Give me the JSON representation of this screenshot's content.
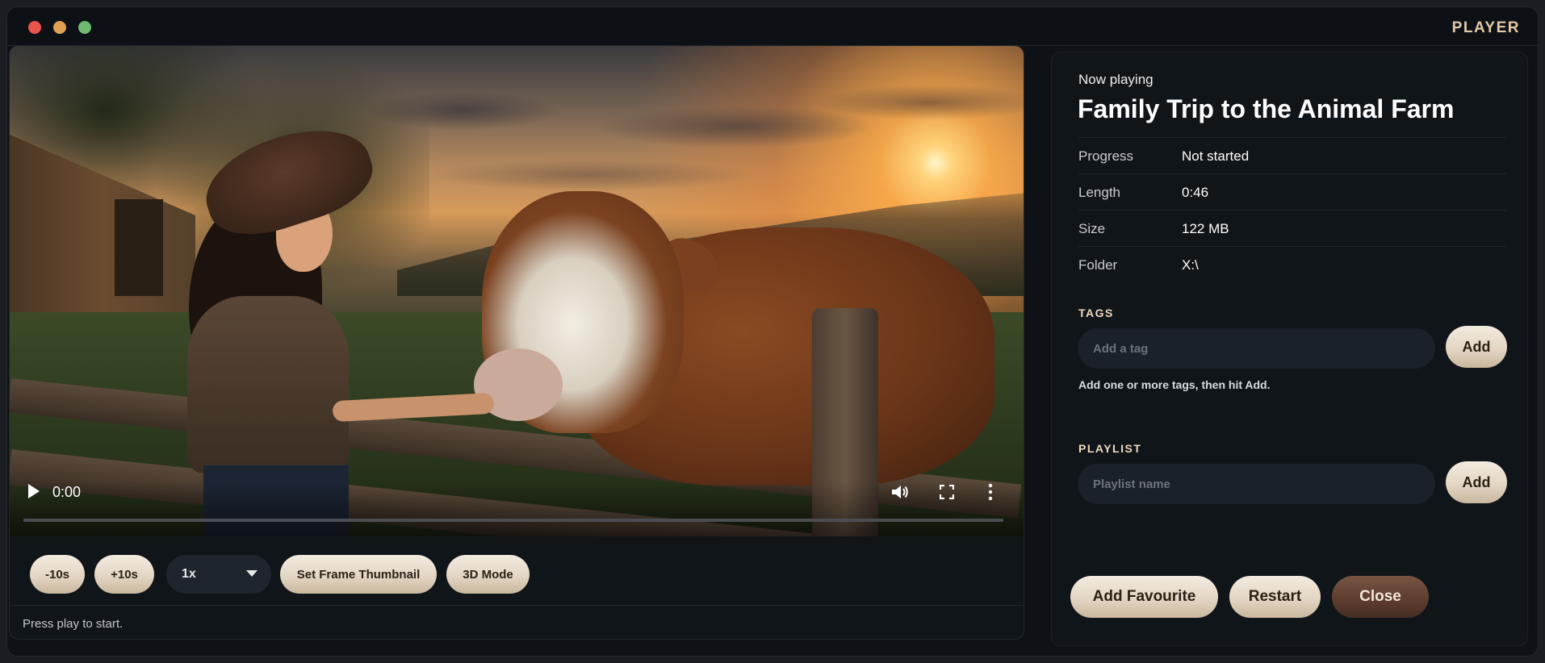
{
  "window": {
    "title": "PLAYER"
  },
  "player": {
    "current_time": "0:00",
    "controls": {
      "rewind_label": "-10s",
      "forward_label": "+10s",
      "speed_value": "1x",
      "thumbnail_label": "Set Frame Thumbnail",
      "mode_label": "3D Mode"
    },
    "status": "Press play to start.",
    "progress": 0
  },
  "info": {
    "now_playing_label": "Now playing",
    "title": "Family Trip to the Animal Farm",
    "rows": [
      {
        "label": "Progress",
        "value": "Not started"
      },
      {
        "label": "Length",
        "value": "0:46"
      },
      {
        "label": "Size",
        "value": "122 MB"
      },
      {
        "label": "Folder",
        "value": "X:\\"
      }
    ]
  },
  "tags": {
    "heading": "TAGS",
    "placeholder": "Add a tag",
    "add_label": "Add",
    "hint": "Add one or more tags, then hit Add."
  },
  "playlist": {
    "heading": "PLAYLIST",
    "placeholder": "Playlist name",
    "add_label": "Add"
  },
  "actions": {
    "favourite_label": "Add Favourite",
    "restart_label": "Restart",
    "close_label": "Close"
  },
  "colors": {
    "accent_light": "#e3d6c3",
    "accent_dark": "#5a3c2e",
    "title_accent": "#e2c9a8",
    "background": "#0e1216"
  },
  "icons": [
    "play-icon",
    "volume-icon",
    "fullscreen-icon",
    "more-vertical-icon",
    "chevron-down-icon"
  ]
}
